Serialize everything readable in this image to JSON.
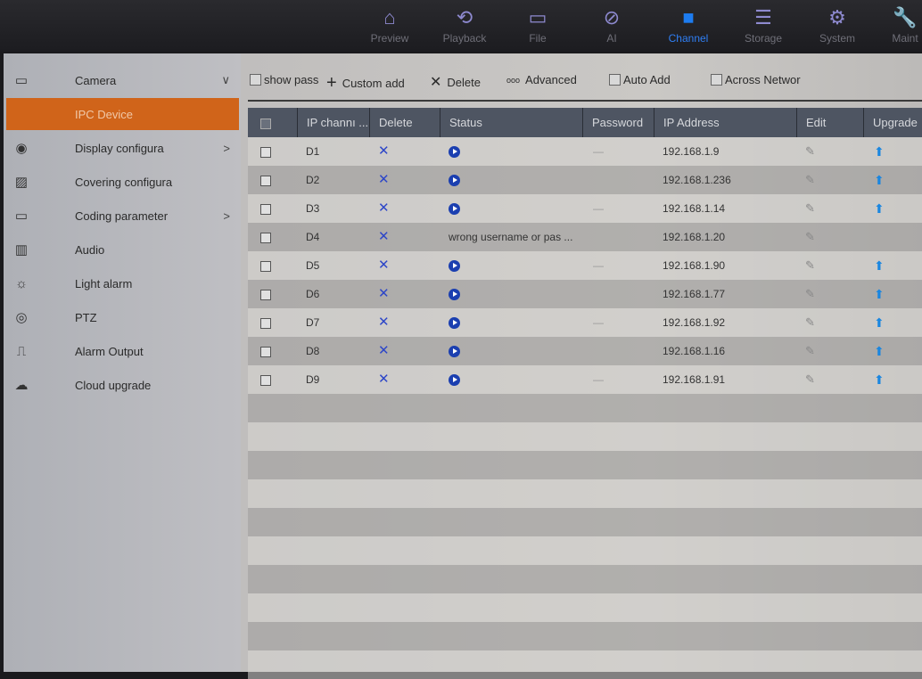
{
  "nav": [
    {
      "label": "Preview",
      "icon": "camera-icon"
    },
    {
      "label": "Playback",
      "icon": "playback-icon"
    },
    {
      "label": "File",
      "icon": "folder-icon"
    },
    {
      "label": "AI",
      "icon": "ai-icon"
    },
    {
      "label": "Channel",
      "icon": "channel-icon",
      "active": true
    },
    {
      "label": "Storage",
      "icon": "database-icon"
    },
    {
      "label": "System",
      "icon": "gear-icon"
    },
    {
      "label": "Maint",
      "icon": "wrench-icon"
    }
  ],
  "sidebar": [
    {
      "label": "Camera",
      "icon": "camera-settings-icon",
      "chevron": "∨"
    },
    {
      "label": "IPC Device",
      "selected": true
    },
    {
      "label": "Display configura",
      "icon": "eye-icon",
      "chevron": ">"
    },
    {
      "label": "Covering configura",
      "icon": "mask-icon"
    },
    {
      "label": "Coding parameter",
      "icon": "encoder-icon",
      "chevron": ">"
    },
    {
      "label": "Audio",
      "icon": "audio-icon"
    },
    {
      "label": "Light alarm",
      "icon": "bulb-icon"
    },
    {
      "label": "PTZ",
      "icon": "ptz-icon"
    },
    {
      "label": "Alarm Output",
      "icon": "alarm-output-icon"
    },
    {
      "label": "Cloud upgrade",
      "icon": "cloud-upload-icon"
    }
  ],
  "toolbar": {
    "show_pass": "show pass",
    "custom_add": "Custom add",
    "delete": "Delete",
    "advanced": "Advanced",
    "auto_add": "Auto Add",
    "across_network": "Across Networ"
  },
  "table": {
    "headers": [
      "IP channı ...",
      "Delete",
      "Status",
      "Password",
      "IP Address",
      "Edit",
      "Upgrade"
    ],
    "rows": [
      {
        "channel": "D1",
        "status": "play",
        "password": "—",
        "ip": "192.168.1.9",
        "upgrade": true
      },
      {
        "channel": "D2",
        "status": "play",
        "password": "",
        "ip": "192.168.1.236",
        "upgrade": true
      },
      {
        "channel": "D3",
        "status": "play",
        "password": "—",
        "ip": "192.168.1.14",
        "upgrade": true
      },
      {
        "channel": "D4",
        "status": "wrong username or pas ...",
        "password": "",
        "ip": "192.168.1.20",
        "upgrade": false
      },
      {
        "channel": "D5",
        "status": "play",
        "password": "—",
        "ip": "192.168.1.90",
        "upgrade": true
      },
      {
        "channel": "D6",
        "status": "play",
        "password": "",
        "ip": "192.168.1.77",
        "upgrade": true
      },
      {
        "channel": "D7",
        "status": "play",
        "password": "—",
        "ip": "192.168.1.92",
        "upgrade": true
      },
      {
        "channel": "D8",
        "status": "play",
        "password": "",
        "ip": "192.168.1.16",
        "upgrade": true
      },
      {
        "channel": "D9",
        "status": "play",
        "password": "—",
        "ip": "192.168.1.91",
        "upgrade": true
      }
    ]
  },
  "colors": {
    "accent": "#d0641a",
    "active_nav": "#2f7ff5",
    "header": "#4e5562"
  }
}
